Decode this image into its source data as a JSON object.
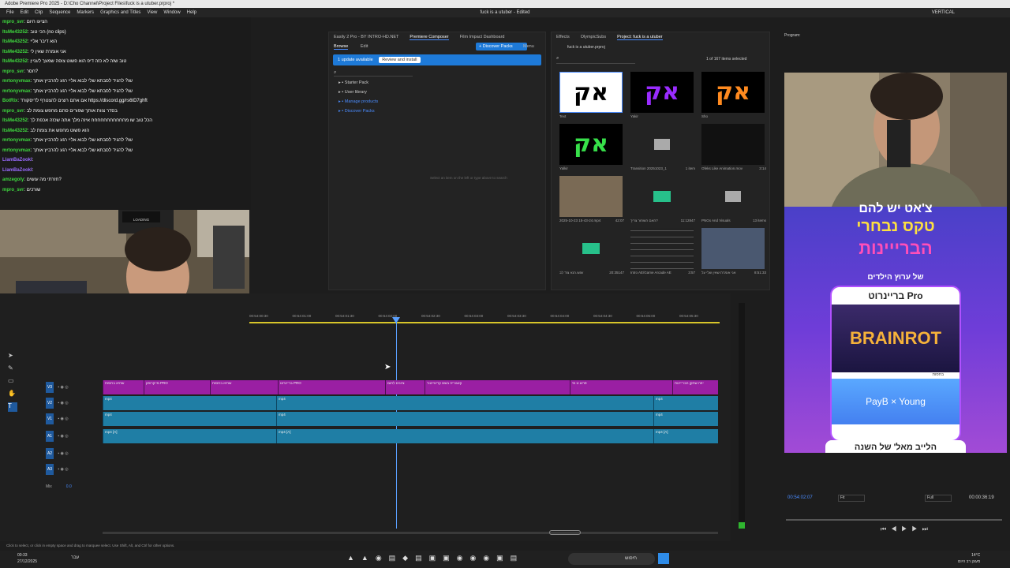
{
  "titlebar": {
    "text": "Adobe Premiere Pro 2025 - D:\\Cho Channel\\Project Files\\fuck is a utuber.prproj *"
  },
  "menubar": {
    "items": [
      "File",
      "Edit",
      "Clip",
      "Sequence",
      "Markers",
      "Graphics and Titles",
      "View",
      "Window",
      "Help"
    ],
    "center_title": "fuck is a utuber - Edited",
    "right_label": "VERTICAL"
  },
  "chat": {
    "lines": [
      {
        "user": "mpro_svr",
        "text": ": הציעו היום",
        "color": "g"
      },
      {
        "user": "ItsMe43252",
        "text": ": הכי טוב (no clips)",
        "color": "g"
      },
      {
        "user": "ItsMe43252",
        "text": ": הוא דיבר אליי",
        "color": "g"
      },
      {
        "user": "ItsMe43252",
        "text": ": אני אומרת שאין לי",
        "color": "g"
      },
      {
        "user": "ItsMe43252",
        "text": ": טוב שזה לא כזה דיפ הוא פשוט צופה שמעך לעניין",
        "color": "g"
      },
      {
        "user": "mpro_svr",
        "text": ": חסר?",
        "color": "g"
      },
      {
        "user": "mrtonyvmax",
        "text": ": שו? להגיד לסבתא שלי לבוא אליי רגע להרביץ אותך",
        "color": "g"
      },
      {
        "user": "mrtonyvmax",
        "text": ": שו? להגיד לסבתא שלי לבוא אליי רגע להרביץ אותך",
        "color": "g"
      },
      {
        "user": "BotRix",
        "text": ": אם אתם רוצים להצטרף לדיסקורד https://discord.gg/rs6tD7ghft",
        "color": "g"
      },
      {
        "user": "mpro_svr",
        "text": ": בסדר צוות אותך שפורים סתם מחפש צומת לב",
        "color": "g"
      },
      {
        "user": "ItsMe43252",
        "text": ": הכל טוב שו מחחחחחחחחחחח איזה מלך אתה שכזה אכפת לך",
        "color": "g"
      },
      {
        "user": "ItsMe43252",
        "text": ": הוא פשוט מחפש את צומת לב",
        "color": "g"
      },
      {
        "user": "mrtonyvmax",
        "text": ": שו? להגיד לסבתא שלי לבוא אליי רגע להרביץ אותך",
        "color": "g"
      },
      {
        "user": "mrtonyvmax",
        "text": ": שו? להגיד לסבתא שלי לבוא אליי רגע להרביץ אותך",
        "color": "g"
      },
      {
        "user": "LlamBaZookI",
        "text": ":",
        "color": "v"
      },
      {
        "user": "LlamBaZookI",
        "text": ":",
        "color": "v"
      },
      {
        "user": "amzegoly",
        "text": ": חזרתי מה עושים?",
        "color": "g"
      },
      {
        "user": "mpro_svr",
        "text": ": שורכים",
        "color": "g"
      }
    ]
  },
  "webcam": {
    "loading_label": "LOADING"
  },
  "browse_panel": {
    "tabs": [
      "Easily 2 Pro - BY INTRO-HD.NET",
      "Premiere Composer",
      "Film Impact Dashboard"
    ],
    "subtabs": [
      "Browse",
      "Edit"
    ],
    "discover_button": "Discover Packs",
    "menu_label": "Menu",
    "update_text": "1 update available",
    "update_button": "Review and install",
    "tree": [
      "Starter Pack",
      "User library",
      "Manage products",
      "Discover Packs"
    ],
    "placeholder": "Select an item on the left or type above to search"
  },
  "project_panel": {
    "tabs": [
      "Effects",
      "OlympicSubs",
      "Project: fuck is a utuber"
    ],
    "file": "fuck is a utuber.prproj",
    "count": "1 of 167 items selected",
    "items": [
      {
        "label": "Text",
        "meta": ""
      },
      {
        "label": "Yakir",
        "meta": ""
      },
      {
        "label": "Sho",
        "meta": ""
      },
      {
        "label": "Yalkir",
        "meta": ""
      },
      {
        "label": "Transition 20251023_1",
        "meta": "1 item"
      },
      {
        "label": "Ofeks Like Animation.mov",
        "meta": "3:14"
      },
      {
        "label": "2025-10-23 15-43-24.mp4",
        "meta": "42:07"
      },
      {
        "label": "האם השחור צריך?",
        "meta": "11:12847"
      },
      {
        "label": "PNGs And Visuals",
        "meta": "13 items"
      },
      {
        "label": "הנא צוד לב.wav",
        "meta": "20:35147"
      },
      {
        "label": "Intro AE/Game Arcade AE",
        "meta": "3:57"
      },
      {
        "label": "אני אומרת שאין שלי על",
        "meta": "8:51:33"
      }
    ]
  },
  "timeline": {
    "ruler": [
      "00:54:00:30",
      "00:54:01:00",
      "00:54:01:30",
      "00:54:02:00",
      "00:54:02:30",
      "00:54:03:00",
      "00:54:03:30",
      "00:54:04:00",
      "00:54:04:30",
      "00:54:05:00",
      "00:54:05:30"
    ],
    "tracks": [
      "V3",
      "V2",
      "V1",
      "A1",
      "A2",
      "A3",
      "Mix"
    ],
    "mix_value": "0.0",
    "v3_clips": [
      "שחיא בחסות",
      "מייקרופון PRO",
      "שחיא בחסות",
      "בריינרוט PRO",
      "ציונים לחום",
      "קטגוריה בשם קריאייטור",
      "פרוע ט מי",
      "יוזה שחקן הברייינות"
    ],
    "v_clip_label": "mp4",
    "a_clip_label": "mp4 [A]"
  },
  "program": {
    "label": "Program:",
    "timecode": "00:54:02:07",
    "fit": "Fit",
    "quality": "Full",
    "duration": "00:00:36:19",
    "overlay": {
      "line1": "צ'אט יש להם",
      "line2": "טקס נבחרי",
      "line3": "הברייינות",
      "line4": "של ערוץ הילדים",
      "line5": "בריינרוט Pro",
      "brand": "BRAINROT",
      "sponsor": "בחסות",
      "pay_text": "PayB × Young",
      "line6": "הלייב מאל' של השנה"
    }
  },
  "status": {
    "text": "Click to select, or click in empty space and drag to marquee select. Use Shift, Alt, and Ctrl for other options."
  },
  "taskbar": {
    "time": "00:33",
    "date": "27/12/2025",
    "lang": "עבר",
    "search": "חיפוש",
    "weather_temp": "14°C",
    "weather_text": "מעונן רב היום"
  },
  "colors": {
    "accent": "#4a8cff",
    "v3": "#9a1fa3",
    "video": "#1f7ea5"
  }
}
